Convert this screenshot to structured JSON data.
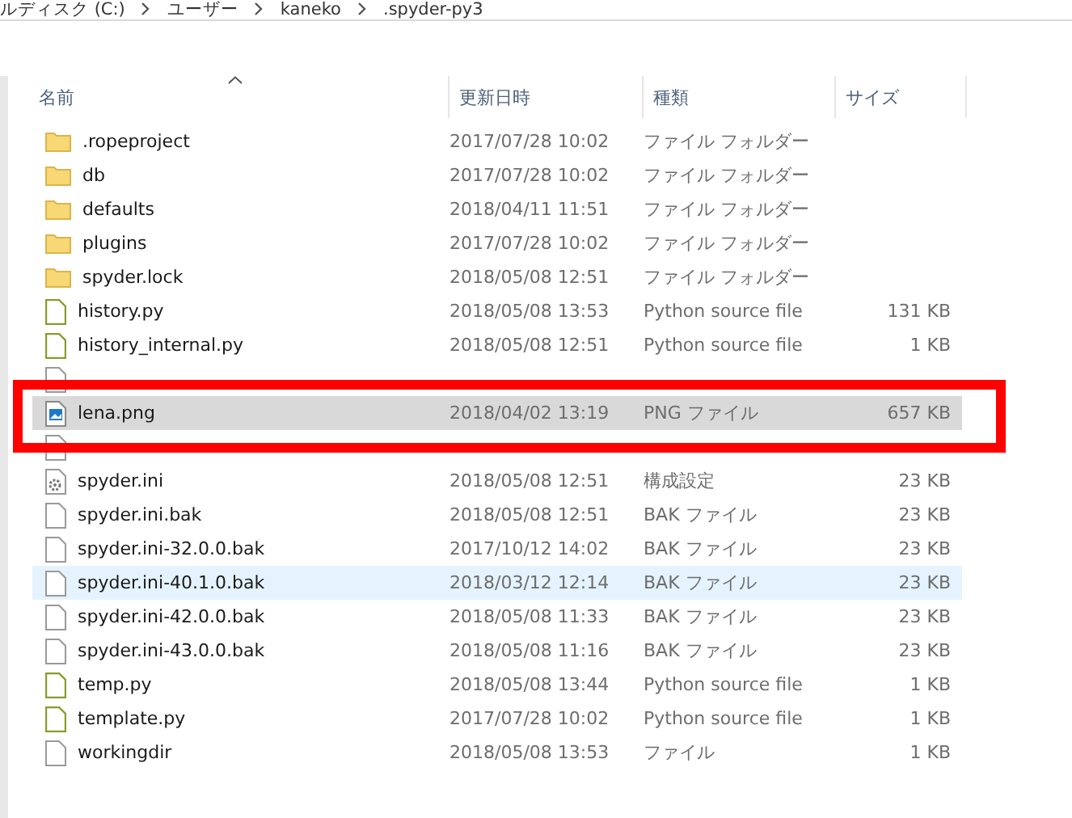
{
  "breadcrumb": [
    "ルディスク (C:)",
    "ユーザー",
    "kaneko",
    ".spyder-py3"
  ],
  "columns": [
    {
      "label": "名前",
      "sorted": true
    },
    {
      "label": "更新日時",
      "sorted": false
    },
    {
      "label": "種類",
      "sorted": false
    },
    {
      "label": "サイズ",
      "sorted": false
    }
  ],
  "rows": [
    {
      "kind": "folder",
      "name": ".ropeproject",
      "date": "2017/07/28 10:02",
      "type": "ファイル フォルダー",
      "size": "",
      "selected": false,
      "hovered": false
    },
    {
      "kind": "folder",
      "name": "db",
      "date": "2017/07/28 10:02",
      "type": "ファイル フォルダー",
      "size": "",
      "selected": false,
      "hovered": false
    },
    {
      "kind": "folder",
      "name": "defaults",
      "date": "2018/04/11 11:51",
      "type": "ファイル フォルダー",
      "size": "",
      "selected": false,
      "hovered": false
    },
    {
      "kind": "folder",
      "name": "plugins",
      "date": "2017/07/28 10:02",
      "type": "ファイル フォルダー",
      "size": "",
      "selected": false,
      "hovered": false
    },
    {
      "kind": "folder",
      "name": "spyder.lock",
      "date": "2018/05/08 12:51",
      "type": "ファイル フォルダー",
      "size": "",
      "selected": false,
      "hovered": false
    },
    {
      "kind": "python",
      "name": "history.py",
      "date": "2018/05/08 13:53",
      "type": "Python source file",
      "size": "131 KB",
      "selected": false,
      "hovered": false
    },
    {
      "kind": "python",
      "name": "history_internal.py",
      "date": "2018/05/08 12:51",
      "type": "Python source file",
      "size": "1 KB",
      "selected": false,
      "hovered": false
    },
    {
      "kind": "file",
      "selected": false,
      "hovered": false
    },
    {
      "kind": "image",
      "name": "lena.png",
      "date": "2018/04/02 13:19",
      "type": "PNG ファイル",
      "size": "657 KB",
      "selected": true,
      "hovered": false
    },
    {
      "kind": "file",
      "selected": false,
      "hovered": false
    },
    {
      "kind": "settings",
      "name": "spyder.ini",
      "date": "2018/05/08 12:51",
      "type": "構成設定",
      "size": "23 KB",
      "selected": false,
      "hovered": false
    },
    {
      "kind": "file",
      "name": "spyder.ini.bak",
      "date": "2018/05/08 12:51",
      "type": "BAK ファイル",
      "size": "23 KB",
      "selected": false,
      "hovered": false
    },
    {
      "kind": "file",
      "name": "spyder.ini-32.0.0.bak",
      "date": "2017/10/12 14:02",
      "type": "BAK ファイル",
      "size": "23 KB",
      "selected": false,
      "hovered": false
    },
    {
      "kind": "file",
      "name": "spyder.ini-40.1.0.bak",
      "date": "2018/03/12 12:14",
      "type": "BAK ファイル",
      "size": "23 KB",
      "selected": false,
      "hovered": true
    },
    {
      "kind": "file",
      "name": "spyder.ini-42.0.0.bak",
      "date": "2018/05/08 11:33",
      "type": "BAK ファイル",
      "size": "23 KB",
      "selected": false,
      "hovered": false
    },
    {
      "kind": "file",
      "name": "spyder.ini-43.0.0.bak",
      "date": "2018/05/08 11:16",
      "type": "BAK ファイル",
      "size": "23 KB",
      "selected": false,
      "hovered": false
    },
    {
      "kind": "python",
      "name": "temp.py",
      "date": "2018/05/08 13:44",
      "type": "Python source file",
      "size": "1 KB",
      "selected": false,
      "hovered": false
    },
    {
      "kind": "python",
      "name": "template.py",
      "date": "2017/07/28 10:02",
      "type": "Python source file",
      "size": "1 KB",
      "selected": false,
      "hovered": false
    },
    {
      "kind": "file",
      "name": "workingdir",
      "date": "2018/05/08 13:53",
      "type": "ファイル",
      "size": "1 KB",
      "selected": false,
      "hovered": false
    }
  ]
}
